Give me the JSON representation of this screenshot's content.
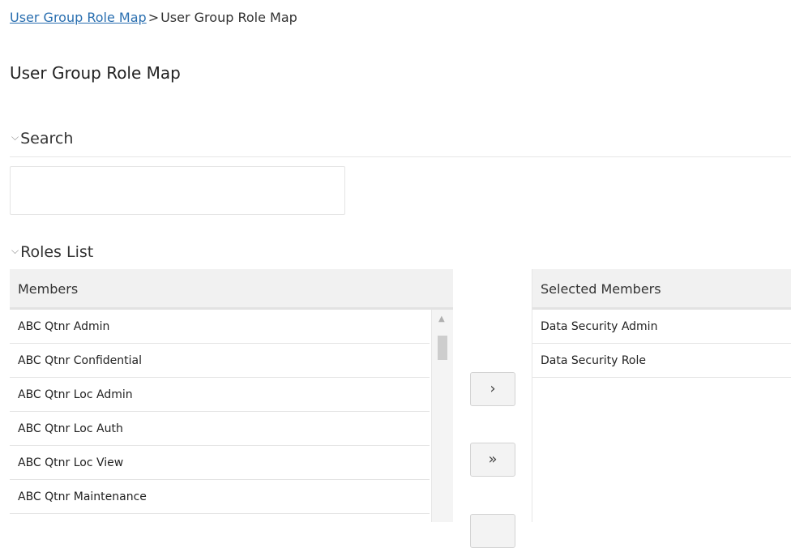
{
  "breadcrumb": {
    "parent_link": "User Group Role Map",
    "separator": ">",
    "current": "User Group Role Map"
  },
  "page_title": "User Group Role Map",
  "search_section": {
    "title": "Search",
    "input_value": "",
    "input_placeholder": ""
  },
  "roles_section": {
    "title": "Roles List",
    "members": {
      "header": "Members",
      "items": [
        "ABC Qtnr Admin",
        "ABC Qtnr Confidential",
        "ABC Qtnr Loc Admin",
        "ABC Qtnr Loc Auth",
        "ABC Qtnr Loc View",
        "ABC Qtnr Maintenance"
      ]
    },
    "buttons": {
      "move_selected": "›",
      "move_all": "»"
    },
    "selected_members": {
      "header": "Selected Members",
      "items": [
        "Data Security Admin",
        "Data Security Role"
      ]
    }
  },
  "icons": {
    "section_toggle": "chevron-down-icon",
    "scroll_up": "scroll-up-arrow-icon"
  },
  "colors": {
    "link": "#2a6fb0",
    "header_bg": "#f1f1f1"
  }
}
